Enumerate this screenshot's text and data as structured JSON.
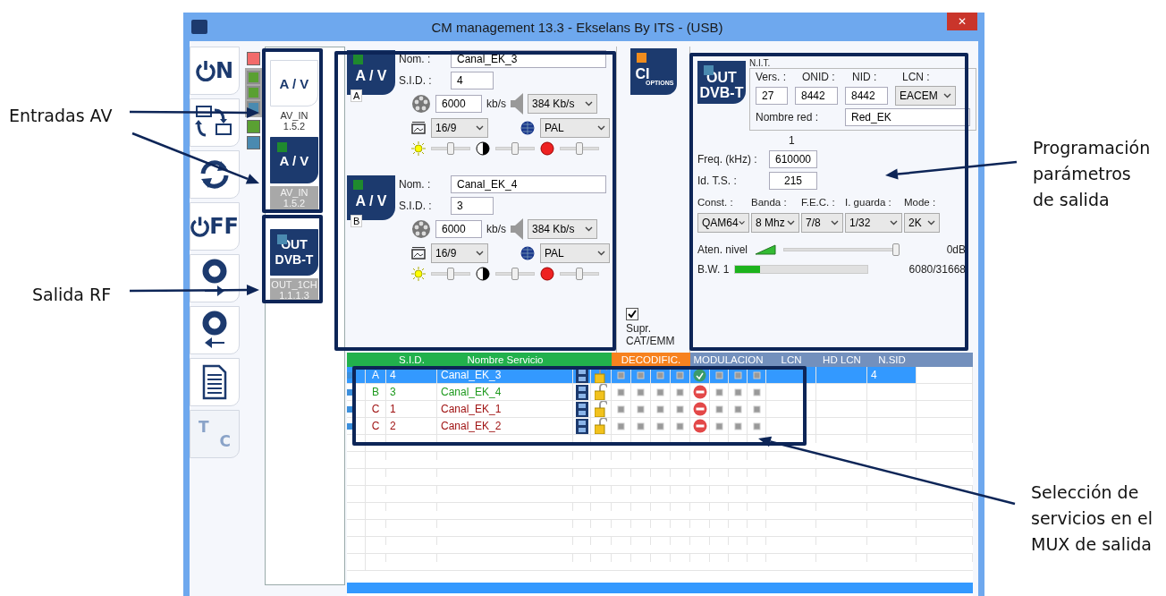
{
  "window": {
    "title": "CM management 13.3 - Ekselans By ITS - (USB)",
    "close": "✕"
  },
  "toolbar": [
    {
      "kind": "power",
      "text": "N",
      "disabled": false
    },
    {
      "kind": "swap",
      "disabled": false
    },
    {
      "kind": "refresh",
      "disabled": false
    },
    {
      "kind": "power",
      "text": "FF",
      "disabled": false
    },
    {
      "kind": "disc-out",
      "disabled": false
    },
    {
      "kind": "disc-in",
      "disabled": false
    },
    {
      "kind": "document",
      "disabled": false
    },
    {
      "kind": "tc",
      "text": "T",
      "text2": "C",
      "disabled": true
    }
  ],
  "status_leds": [
    {
      "color": "#f26b6b",
      "grouped": false
    },
    {
      "color": "#5aa032",
      "grouped": true
    },
    {
      "color": "#5aa032",
      "grouped": true
    },
    {
      "color": "#4a8ab0",
      "grouped": true
    },
    {
      "color": "#5aa032",
      "grouped": false
    },
    {
      "color": "#4a8ab0",
      "grouped": false
    }
  ],
  "modules": [
    {
      "kind": "av",
      "title": [
        "A / V"
      ],
      "label": [
        "AV_IN",
        "1.5.2"
      ],
      "selected": false
    },
    {
      "kind": "av",
      "title": [
        "A / V"
      ],
      "label": [
        "AV_IN",
        "1.5.2"
      ],
      "selected": true
    },
    {
      "kind": "out",
      "title": [
        "OUT",
        "DVB-T"
      ],
      "label": [
        "OUT_1CH",
        "1.1.1.3"
      ],
      "selected": true
    }
  ],
  "av_channels": [
    {
      "badge": "A / V",
      "letter": "A",
      "name_label": "Nom. :",
      "name": "Canal_EK_3",
      "sid_label": "S.I.D. :",
      "sid": "4",
      "bitrate": "6000",
      "bitrate_unit": "kb/s",
      "audio": "384 Kb/s",
      "aspect": "16/9",
      "system": "PAL",
      "brightness": {
        "level": 0.5
      },
      "contrast": {
        "level": 0.5
      },
      "saturation": {
        "level": 0.5
      }
    },
    {
      "badge": "A / V",
      "letter": "B",
      "name_label": "Nom. :",
      "name": "Canal_EK_4",
      "sid_label": "S.I.D. :",
      "sid": "3",
      "bitrate": "6000",
      "bitrate_unit": "kb/s",
      "audio": "384 Kb/s",
      "aspect": "16/9",
      "system": "PAL",
      "brightness": {
        "level": 0.5
      },
      "contrast": {
        "level": 0.5
      },
      "saturation": {
        "level": 0.5
      }
    }
  ],
  "ci_button": {
    "title": "CI",
    "subtitle": "OPTIONS"
  },
  "supr_checkbox": {
    "label": [
      "Supr.",
      "CAT/EMM"
    ],
    "checked": true
  },
  "output": {
    "badge": [
      "OUT",
      "DVB-T"
    ],
    "nit": {
      "legend": "N.I.T.",
      "vers_label": "Vers. :",
      "vers": "27",
      "onid_label": "ONID :",
      "onid": "8442",
      "nid_label": "NID :",
      "nid": "8442",
      "lcn_label": "LCN :",
      "lcn": "EACEM",
      "net_label": "Nombre red :",
      "net": "Red_EK"
    },
    "channel": "1",
    "freq_label": "Freq. (kHz) :",
    "freq": "610000",
    "ts_label": "Id. T.S. :",
    "ts": "215",
    "params": [
      {
        "label": "Const. :",
        "value": "QAM64"
      },
      {
        "label": "Banda :",
        "value": "8 Mhz"
      },
      {
        "label": "F.E.C. :",
        "value": "7/8"
      },
      {
        "label": "I. guarda :",
        "value": "1/32"
      },
      {
        "label": "Mode :",
        "value": "2K"
      }
    ],
    "attenuation": {
      "label": "Aten. nivel",
      "level": 1.0,
      "reading": "0dB"
    },
    "bandwidth": {
      "label": "B.W. 1",
      "level": 0.19,
      "reading": "6080/31668"
    }
  },
  "table": {
    "header": [
      {
        "label": "S.I.D.",
        "color": "#22b14c"
      },
      {
        "label": "Nombre Servicio",
        "color": "#22b14c"
      },
      {
        "label": "DECODIFIC.",
        "color": "#f7821e"
      },
      {
        "label": "MODULACION",
        "color": "#7390bd"
      },
      {
        "label": "LCN",
        "color": "#7390bd"
      },
      {
        "label": "HD LCN",
        "color": "#7390bd"
      },
      {
        "label": "N.SID",
        "color": "#7390bd"
      }
    ],
    "rows": [
      {
        "letter": "A",
        "sid": "4",
        "name": "Canal_EK_3",
        "color": "#ffffff",
        "selected": true,
        "blocked": false,
        "n_sid": "4"
      },
      {
        "letter": "B",
        "sid": "3",
        "name": "Canal_EK_4",
        "color": "#1f9a1f",
        "selected": false,
        "blocked": true
      },
      {
        "letter": "C",
        "sid": "1",
        "name": "Canal_EK_1",
        "color": "#a01414",
        "selected": false,
        "blocked": true
      },
      {
        "letter": "C",
        "sid": "2",
        "name": "Canal_EK_2",
        "color": "#a01414",
        "selected": false,
        "blocked": true
      }
    ]
  },
  "callouts": [
    {
      "lines": [
        "Entradas AV"
      ]
    },
    {
      "lines": [
        "Salida RF"
      ]
    },
    {
      "lines": [
        "Programación",
        "parámetros",
        "de salida"
      ]
    },
    {
      "lines": [
        "Selección de",
        "servicios en el",
        "MUX de salida"
      ]
    }
  ]
}
